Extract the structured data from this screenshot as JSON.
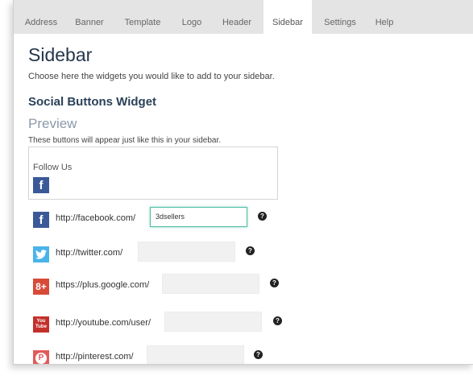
{
  "tabs": [
    {
      "label": "Address"
    },
    {
      "label": "Banner"
    },
    {
      "label": "Template"
    },
    {
      "label": "Logo"
    },
    {
      "label": "Header"
    },
    {
      "label": "Sidebar"
    },
    {
      "label": "Settings"
    },
    {
      "label": "Help"
    }
  ],
  "active_tab": "Sidebar",
  "page": {
    "title": "Sidebar",
    "description": "Choose here the widgets you would like to add to your sidebar."
  },
  "widget": {
    "title": "Social Buttons Widget",
    "preview_title": "Preview",
    "preview_description": "These buttons will appear just like this in your sidebar.",
    "follow_label": "Follow Us",
    "preview_icon": "facebook-icon"
  },
  "social": [
    {
      "network": "facebook",
      "icon": "facebook-icon",
      "color": "#3b5998",
      "glyph": "f",
      "url": "http://facebook.com/",
      "value": "3dsellers"
    },
    {
      "network": "twitter",
      "icon": "twitter-icon",
      "color": "#4ab3ea",
      "glyph": "",
      "url": "http://twitter.com/",
      "value": ""
    },
    {
      "network": "google-plus",
      "icon": "google-plus-icon",
      "color": "#d84a38",
      "glyph": "8+",
      "url": "https://plus.google.com/",
      "value": ""
    },
    {
      "network": "youtube",
      "icon": "youtube-icon",
      "color": "#c4302b",
      "glyph": "You Tube",
      "url": "http://youtube.com/user/",
      "value": ""
    },
    {
      "network": "pinterest",
      "icon": "pinterest-icon",
      "color": "#e25a5a",
      "glyph": "P",
      "url": "http://pinterest.com/",
      "value": ""
    }
  ],
  "help_glyph": "?"
}
